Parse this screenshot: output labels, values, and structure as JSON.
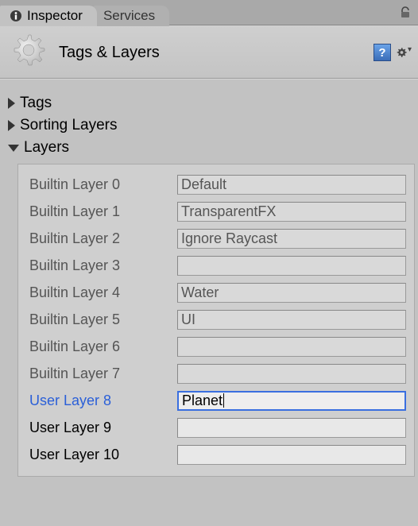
{
  "tabs": {
    "inspector": "Inspector",
    "services": "Services"
  },
  "header": {
    "title": "Tags & Layers"
  },
  "sections": {
    "tags": "Tags",
    "sorting_layers": "Sorting Layers",
    "layers": "Layers"
  },
  "layers": [
    {
      "label": "Builtin Layer 0",
      "value": "Default",
      "kind": "builtin"
    },
    {
      "label": "Builtin Layer 1",
      "value": "TransparentFX",
      "kind": "builtin"
    },
    {
      "label": "Builtin Layer 2",
      "value": "Ignore Raycast",
      "kind": "builtin"
    },
    {
      "label": "Builtin Layer 3",
      "value": "",
      "kind": "builtin"
    },
    {
      "label": "Builtin Layer 4",
      "value": "Water",
      "kind": "builtin"
    },
    {
      "label": "Builtin Layer 5",
      "value": "UI",
      "kind": "builtin"
    },
    {
      "label": "Builtin Layer 6",
      "value": "",
      "kind": "builtin"
    },
    {
      "label": "Builtin Layer 7",
      "value": "",
      "kind": "builtin"
    },
    {
      "label": "User Layer 8",
      "value": "Planet",
      "kind": "user",
      "selected": true,
      "focused": true
    },
    {
      "label": "User Layer 9",
      "value": "",
      "kind": "user"
    },
    {
      "label": "User Layer 10",
      "value": "",
      "kind": "user"
    }
  ]
}
